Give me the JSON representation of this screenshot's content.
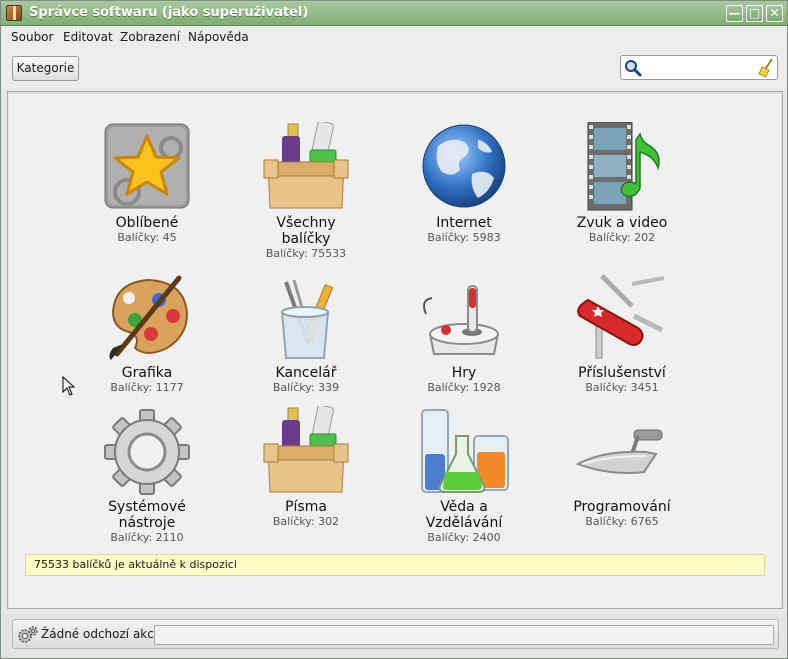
{
  "window": {
    "title": "Správce softwaru (jako superuživatel)",
    "controls": {
      "minimize": "—",
      "maximize": "□",
      "close": "✕"
    }
  },
  "menubar": {
    "items": [
      "Soubor",
      "Editovat",
      "Zobrazení",
      "Nápověda"
    ]
  },
  "toolbar": {
    "category_button": "Kategorie",
    "search": {
      "value": "",
      "placeholder": ""
    }
  },
  "categories": [
    {
      "name": "Oblíbené",
      "count": "Balíčky: 45",
      "icon": "favorites-star-icon"
    },
    {
      "name": "Všechny balíčky",
      "count": "Balíčky: 75533",
      "icon": "all-packages-box-icon"
    },
    {
      "name": "Internet",
      "count": "Balíčky: 5983",
      "icon": "globe-icon"
    },
    {
      "name": "Zvuk a video",
      "count": "Balíčky: 202",
      "icon": "film-music-icon"
    },
    {
      "name": "Grafika",
      "count": "Balíčky: 1177",
      "icon": "palette-icon"
    },
    {
      "name": "Kancelář",
      "count": "Balíčky: 339",
      "icon": "pencil-cup-icon"
    },
    {
      "name": "Hry",
      "count": "Balíčky: 1928",
      "icon": "joystick-icon"
    },
    {
      "name": "Příslušenství",
      "count": "Balíčky: 3451",
      "icon": "swiss-knife-icon"
    },
    {
      "name": "Systémové nástroje",
      "count": "Balíčky: 2110",
      "icon": "gear-icon"
    },
    {
      "name": "Písma",
      "count": "Balíčky: 302",
      "icon": "fonts-box-icon"
    },
    {
      "name": "Věda a Vzdělávání",
      "count": "Balíčky: 2400",
      "icon": "flasks-icon"
    },
    {
      "name": "Programování",
      "count": "Balíčky: 6765",
      "icon": "trowel-icon"
    }
  ],
  "info": "75533 balíčků je aktuálně k dispozici",
  "status": {
    "text": "Žádné odchozí akce",
    "progress": 0
  }
}
